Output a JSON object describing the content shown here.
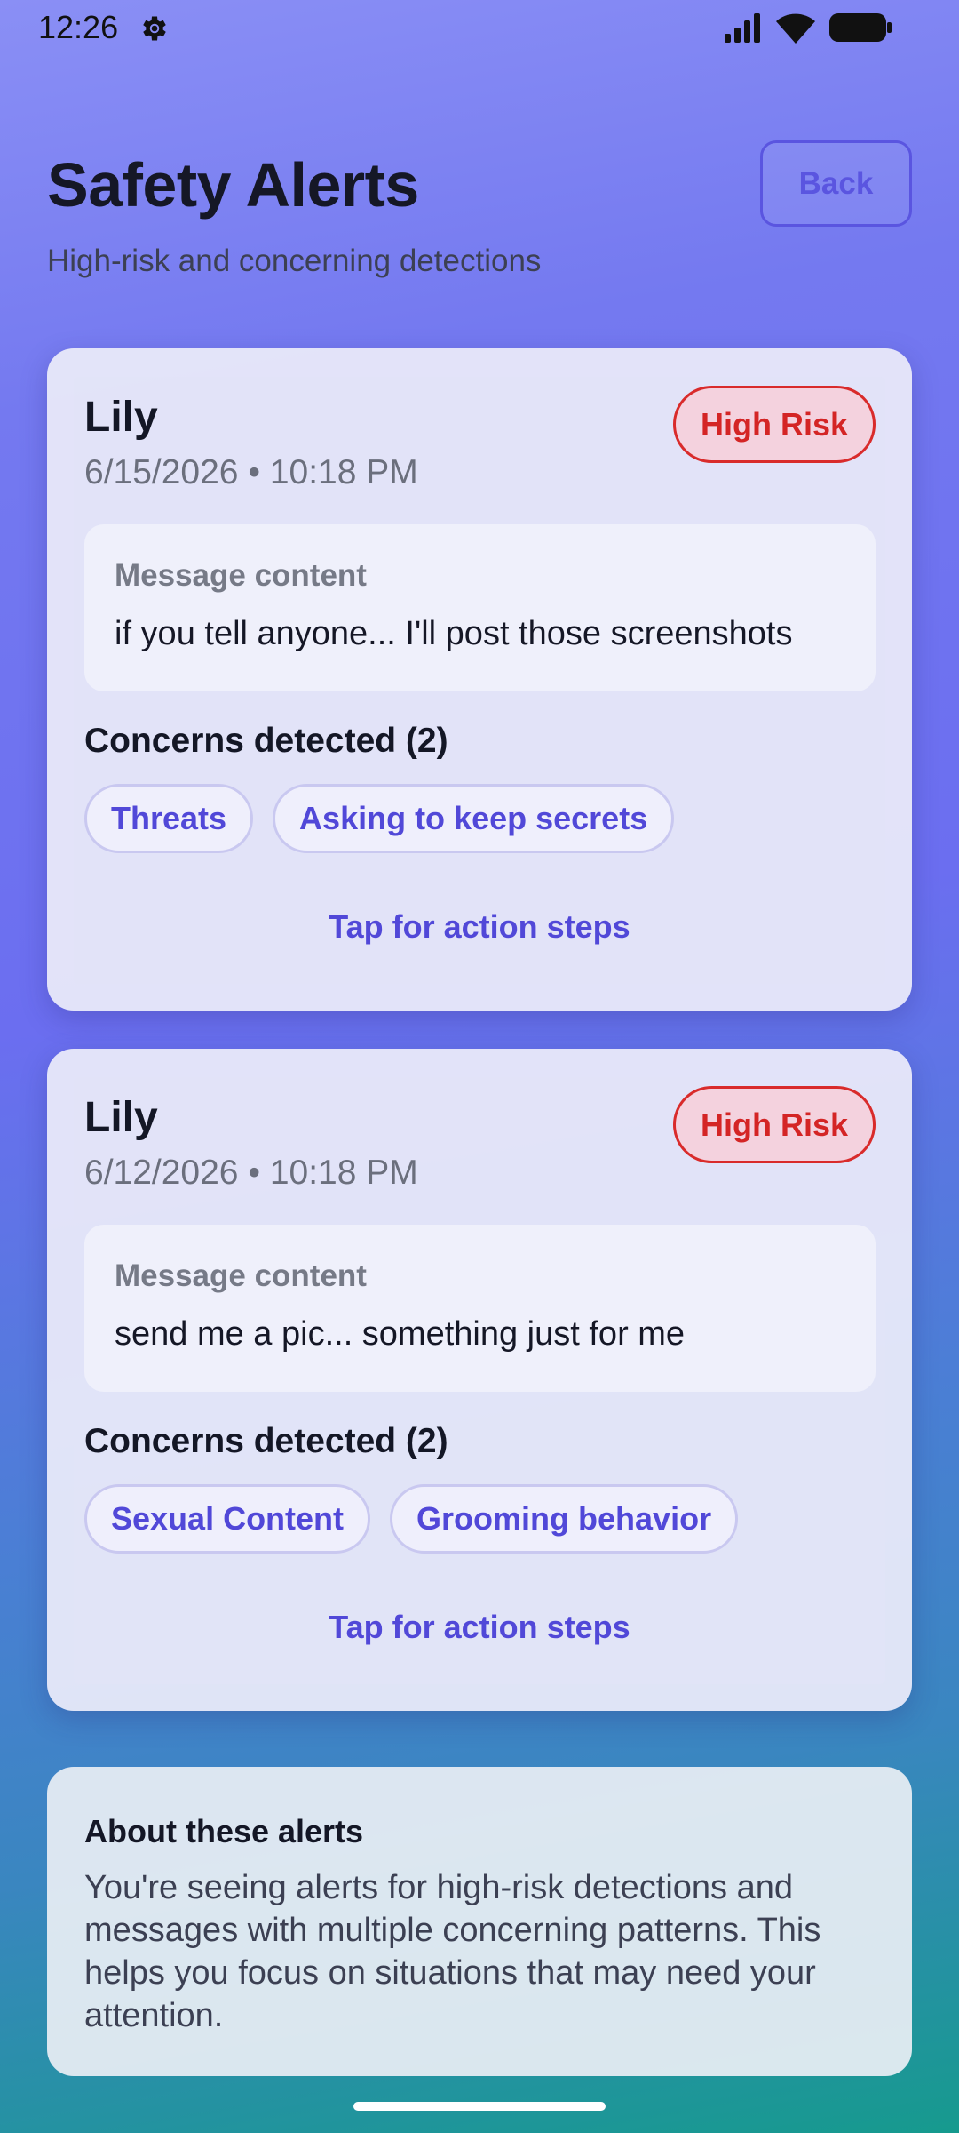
{
  "status_bar": {
    "time": "12:26",
    "settings_icon": "gear-icon",
    "signal_icon": "signal-icon",
    "wifi_icon": "wifi-icon",
    "battery_icon": "battery-icon"
  },
  "header": {
    "title": "Safety Alerts",
    "subtitle": "High-risk and concerning detections",
    "back_label": "Back"
  },
  "colors": {
    "accent": "#5148d8",
    "high_risk": "#d42525",
    "high_risk_bg": "#f4d2de"
  },
  "alerts": [
    {
      "name": "Lily",
      "timestamp": "6/15/2026 • 10:18 PM",
      "risk_label": "High Risk",
      "message_label": "Message content",
      "message": "if you tell anyone... I'll post those screenshots",
      "concerns_title": "Concerns detected (2)",
      "concerns": [
        "Threats",
        "Asking to keep secrets"
      ],
      "action_label": "Tap for action steps"
    },
    {
      "name": "Lily",
      "timestamp": "6/12/2026 • 10:18 PM",
      "risk_label": "High Risk",
      "message_label": "Message content",
      "message": "send me a pic... something just for me",
      "concerns_title": "Concerns detected (2)",
      "concerns": [
        "Sexual Content",
        "Grooming behavior"
      ],
      "action_label": "Tap for action steps"
    }
  ],
  "info": {
    "title": "About these alerts",
    "text": "You're seeing alerts for high-risk detections and messages with multiple concerning patterns. This helps you focus on situations that may need your attention."
  }
}
